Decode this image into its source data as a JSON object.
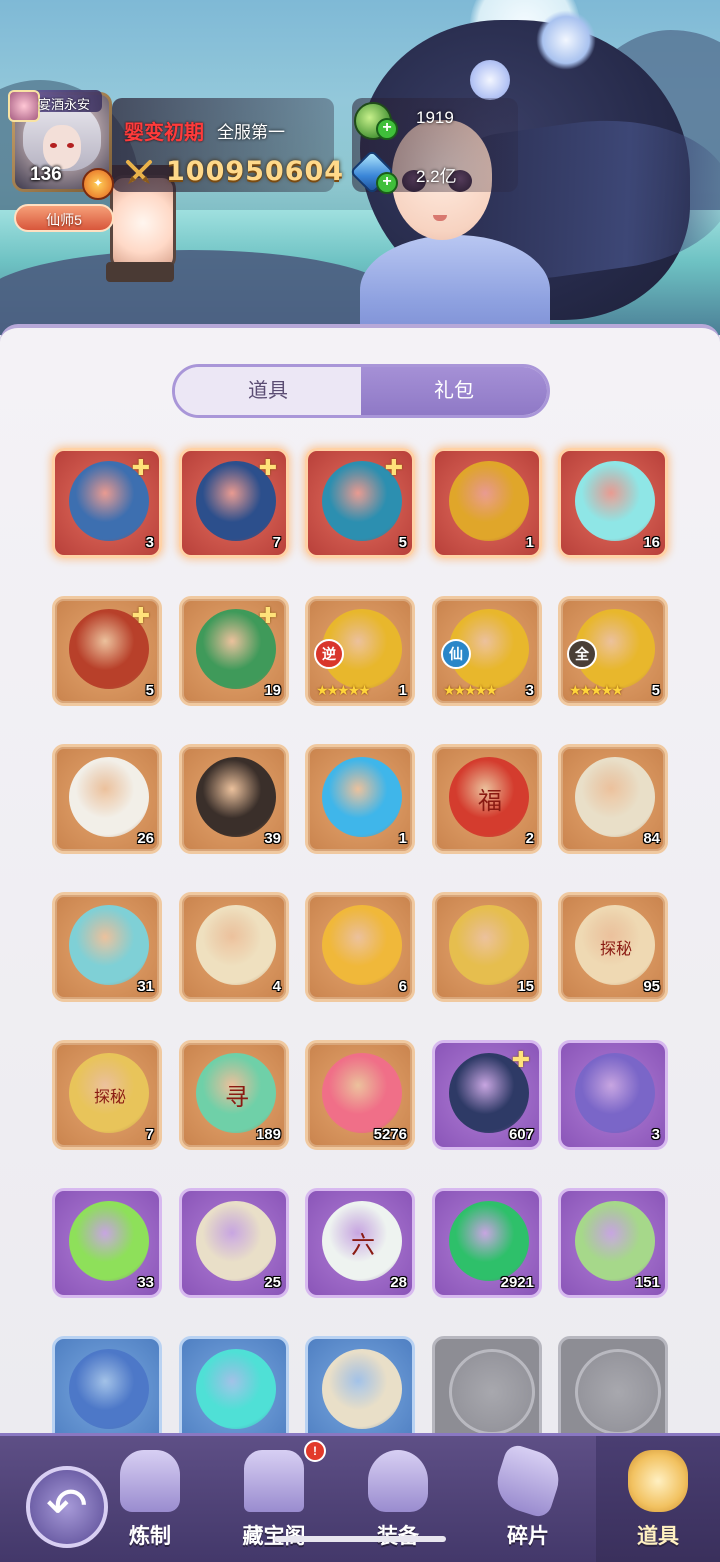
{
  "player": {
    "level": "136",
    "realm": "婴变初期",
    "server_rank": "全服第一",
    "power": "100950604",
    "title": "仙师5",
    "avatar_tag": "宴酒永安"
  },
  "currency": {
    "jade": "1919",
    "gem": "2.2亿"
  },
  "tabs": {
    "props": "道具",
    "gift": "礼包"
  },
  "items": [
    {
      "count": "3",
      "rarity": "red",
      "fragment": true,
      "art": "blue-toad-beast",
      "color": "#3d6fb0"
    },
    {
      "count": "7",
      "rarity": "red",
      "fragment": true,
      "art": "blue-dragon-bear",
      "color": "#2c4f8c"
    },
    {
      "count": "5",
      "rarity": "red",
      "fragment": true,
      "art": "azure-dragon",
      "color": "#2c8fb0"
    },
    {
      "count": "1",
      "rarity": "red",
      "fragment": false,
      "art": "golden-crown",
      "color": "#e0a62a"
    },
    {
      "count": "16",
      "rarity": "red",
      "fragment": false,
      "art": "name-token",
      "color": "#8fe6e6"
    },
    {
      "count": "5",
      "rarity": "orange",
      "fragment": true,
      "art": "red-lion-beast",
      "color": "#b8402a"
    },
    {
      "count": "19",
      "rarity": "orange",
      "fragment": true,
      "art": "green-toad",
      "color": "#3f9a5a"
    },
    {
      "count": "1",
      "rarity": "orange",
      "badge": "逆",
      "badge_color": "red",
      "stars": "★★★★★",
      "art": "gold-coin-face",
      "color": "#e8b72c"
    },
    {
      "count": "3",
      "rarity": "orange",
      "badge": "仙",
      "badge_color": "blue",
      "stars": "★★★★★",
      "art": "gold-coin-face",
      "color": "#e8b72c"
    },
    {
      "count": "5",
      "rarity": "orange",
      "badge": "全",
      "badge_color": "dark",
      "stars": "★★★★★",
      "art": "gold-coin-face",
      "color": "#e8b72c"
    },
    {
      "count": "26",
      "rarity": "orange",
      "art": "white-gourd",
      "color": "#f2efe8"
    },
    {
      "count": "39",
      "rarity": "orange",
      "art": "dark-compass",
      "color": "#3a2f2a"
    },
    {
      "count": "1",
      "rarity": "orange",
      "art": "blue-flame-spirit",
      "color": "#3fb6ea"
    },
    {
      "count": "2",
      "rarity": "orange",
      "art": "fortune-red-envelope",
      "glyph": "福",
      "color": "#d43c2e"
    },
    {
      "count": "84",
      "rarity": "orange",
      "art": "rice-sack",
      "color": "#e9dfc8"
    },
    {
      "count": "31",
      "rarity": "orange",
      "art": "cloud-clock",
      "color": "#7fd0d6"
    },
    {
      "count": "4",
      "rarity": "orange",
      "art": "yin-yang-key",
      "color": "#efe0bf"
    },
    {
      "count": "6",
      "rarity": "orange",
      "art": "golden-sword",
      "color": "#f0b83a"
    },
    {
      "count": "15",
      "rarity": "orange",
      "art": "golden-bell",
      "color": "#e6be4e"
    },
    {
      "count": "95",
      "rarity": "orange",
      "art": "explore-token",
      "glyph": "探秘",
      "color": "#efd9b3"
    },
    {
      "count": "7",
      "rarity": "orange",
      "art": "gold-explore-token",
      "glyph": "探秘",
      "color": "#e8c45a"
    },
    {
      "count": "189",
      "rarity": "orange",
      "art": "jade-seek-token",
      "glyph": "寻",
      "color": "#6fd0a8"
    },
    {
      "count": "5276",
      "rarity": "orange",
      "art": "pink-pearl",
      "color": "#f06f88"
    },
    {
      "count": "607",
      "rarity": "purple",
      "fragment": true,
      "art": "dark-dragon",
      "color": "#2e3a66"
    },
    {
      "count": "3",
      "rarity": "purple",
      "art": "purple-cube-box",
      "color": "#7a66c8"
    },
    {
      "count": "33",
      "rarity": "purple",
      "art": "green-spirit",
      "color": "#8ee05a"
    },
    {
      "count": "25",
      "rarity": "purple",
      "art": "rice-sack",
      "color": "#e9dfc8"
    },
    {
      "count": "28",
      "rarity": "purple",
      "art": "rune-dice",
      "glyph": "六",
      "color": "#eef3f0"
    },
    {
      "count": "2921",
      "rarity": "purple",
      "art": "green-crystal",
      "color": "#2ec06a"
    },
    {
      "count": "151",
      "rarity": "purple",
      "art": "jade-plaque",
      "color": "#a6d88a"
    },
    {
      "count": "",
      "rarity": "blue",
      "art": "blue-cube-box",
      "color": "#4d78c8"
    },
    {
      "count": "",
      "rarity": "blue",
      "art": "teal-flame",
      "color": "#4fe0d6"
    },
    {
      "count": "",
      "rarity": "blue",
      "art": "rice-sack",
      "color": "#e9dfc8"
    },
    {
      "count": "",
      "rarity": "empty",
      "art": "empty-slot",
      "color": "#a8a8ae"
    },
    {
      "count": "",
      "rarity": "empty",
      "art": "empty-slot",
      "color": "#a8a8ae"
    }
  ],
  "nav": {
    "forge": "炼制",
    "treasure": "藏宝阁",
    "equip": "装备",
    "shards": "碎片",
    "props": "道具",
    "treasure_notify": "!"
  }
}
